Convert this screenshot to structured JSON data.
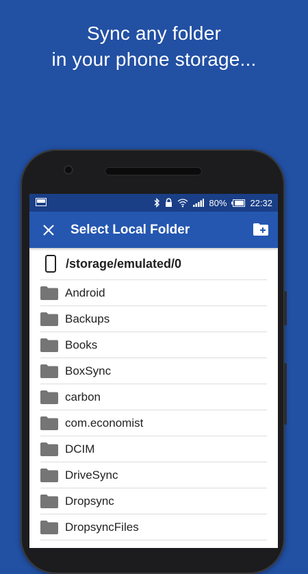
{
  "promo": {
    "line1": "Sync any folder",
    "line2": "in your phone storage..."
  },
  "status_bar": {
    "battery_percent": "80%",
    "time": "22:32",
    "icons": [
      "notification-icon",
      "bluetooth-icon",
      "lock-icon",
      "wifi-icon",
      "signal-icon",
      "battery-icon"
    ]
  },
  "toolbar": {
    "title": "Select Local Folder",
    "close_icon": "close-icon",
    "new_folder_icon": "create-new-folder-icon"
  },
  "current_path": "/storage/emulated/0",
  "folders": [
    "Android",
    "Backups",
    "Books",
    "BoxSync",
    "carbon",
    "com.economist",
    "DCIM",
    "DriveSync",
    "Dropsync",
    "DropsyncFiles"
  ],
  "colors": {
    "background": "#2250a3",
    "status_bar": "#1a3f87",
    "toolbar": "#2557b0",
    "folder_icon": "#757575"
  }
}
